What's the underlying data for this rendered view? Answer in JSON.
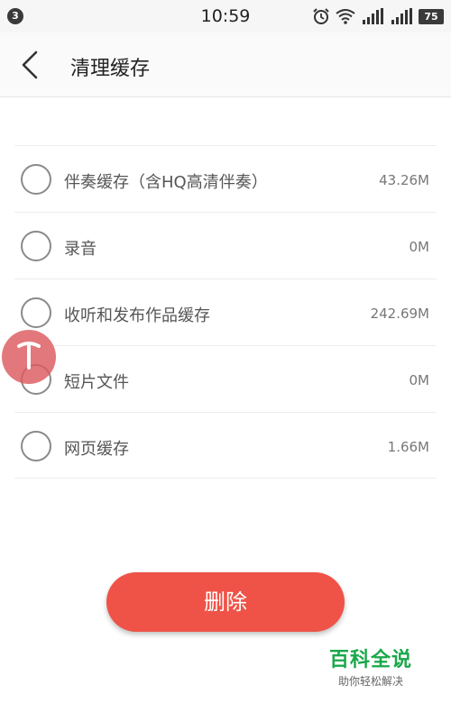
{
  "status_bar": {
    "notification_count": "3",
    "time": "10:59",
    "battery": "75",
    "icons": [
      "alarm-icon",
      "wifi-icon",
      "signal-icon",
      "signal-icon"
    ]
  },
  "header": {
    "title": "清理缓存"
  },
  "cache_items": [
    {
      "label": "伴奏缓存（含HQ高清伴奏）",
      "size": "43.26M",
      "checked": false
    },
    {
      "label": "录音",
      "size": "0M",
      "checked": false
    },
    {
      "label": "收听和发布作品缓存",
      "size": "242.69M",
      "checked": false
    },
    {
      "label": "短片文件",
      "size": "0M",
      "checked": false
    },
    {
      "label": "网页缓存",
      "size": "1.66M",
      "checked": false
    }
  ],
  "delete_button": {
    "label": "删除"
  },
  "watermark": {
    "title": "百科全说",
    "subtitle": "助你轻松解决"
  },
  "colors": {
    "accent": "#ef5347",
    "bubble": "#dc5a5f",
    "watermark": "#1aa84a"
  }
}
